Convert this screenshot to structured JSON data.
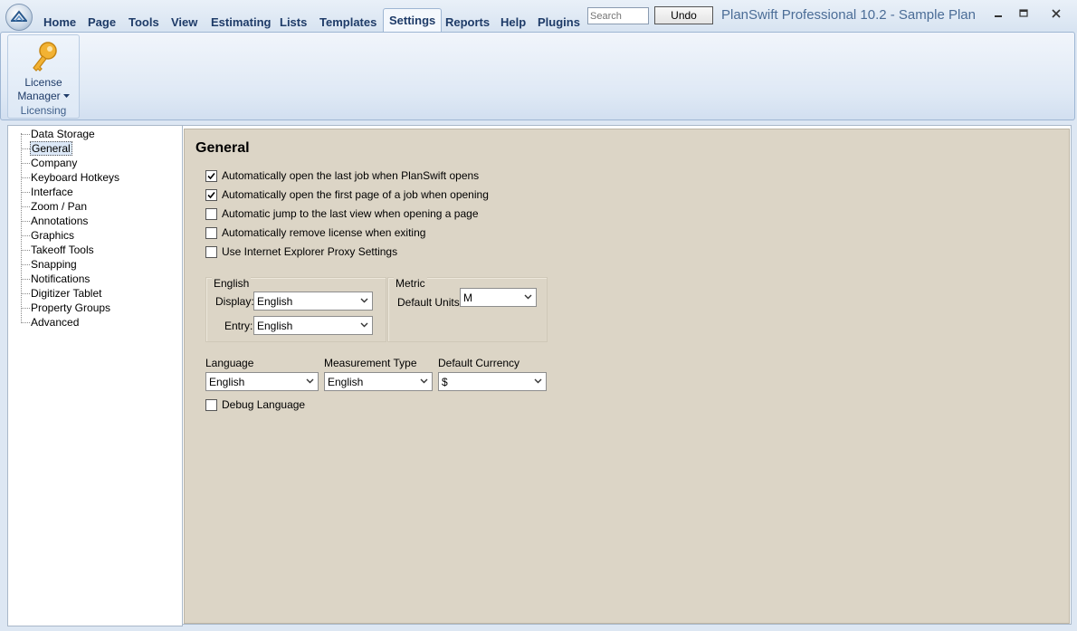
{
  "app": {
    "window_title": "PlanSwift Professional 10.2 - Sample Plan",
    "search_placeholder": "Search",
    "undo_label": "Undo"
  },
  "tabs": [
    {
      "label": "Home"
    },
    {
      "label": "Page"
    },
    {
      "label": "Tools"
    },
    {
      "label": "View"
    },
    {
      "label": "Estimating"
    },
    {
      "label": "Lists"
    },
    {
      "label": "Templates"
    },
    {
      "label": "Settings",
      "active": true
    },
    {
      "label": "Reports"
    },
    {
      "label": "Help"
    },
    {
      "label": "Plugins"
    }
  ],
  "ribbon": {
    "license_button_line1": "License",
    "license_button_line2": "Manager",
    "group_label": "Licensing",
    "icon": "key-icon"
  },
  "tree": {
    "items": [
      {
        "label": "Data Storage"
      },
      {
        "label": "General",
        "selected": true
      },
      {
        "label": "Company"
      },
      {
        "label": "Keyboard Hotkeys"
      },
      {
        "label": "Interface"
      },
      {
        "label": "Zoom / Pan"
      },
      {
        "label": "Annotations"
      },
      {
        "label": "Graphics"
      },
      {
        "label": "Takeoff Tools"
      },
      {
        "label": "Snapping"
      },
      {
        "label": "Notifications"
      },
      {
        "label": "Digitizer Tablet"
      },
      {
        "label": "Property Groups"
      },
      {
        "label": "Advanced"
      }
    ]
  },
  "general": {
    "title": "General",
    "options": [
      {
        "label": "Automatically open the last job when PlanSwift opens",
        "checked": true
      },
      {
        "label": "Automatically open the first page of a job when opening",
        "checked": true
      },
      {
        "label": "Automatic jump to the last view when opening a page",
        "checked": false
      },
      {
        "label": "Automatically remove license when exiting",
        "checked": false
      },
      {
        "label": "Use Internet Explorer Proxy Settings",
        "checked": false
      }
    ],
    "english_group": {
      "title": "English",
      "display_label": "Display:",
      "display_value": "English",
      "entry_label": "Entry:",
      "entry_value": "English"
    },
    "metric_group": {
      "title": "Metric",
      "default_units_label": "Default Units:",
      "default_units_value": "M"
    },
    "language_label": "Language",
    "language_value": "English",
    "measurement_type_label": "Measurement Type",
    "measurement_type_value": "English",
    "default_currency_label": "Default Currency",
    "default_currency_value": "$",
    "debug_language_label": "Debug Language",
    "debug_language_checked": false
  },
  "colors": {
    "tab_text": "#1e3b68",
    "window_title": "#4b6d97",
    "panel_bg": "#dcd5c6",
    "ribbon_bg": "#dfe9f5"
  }
}
